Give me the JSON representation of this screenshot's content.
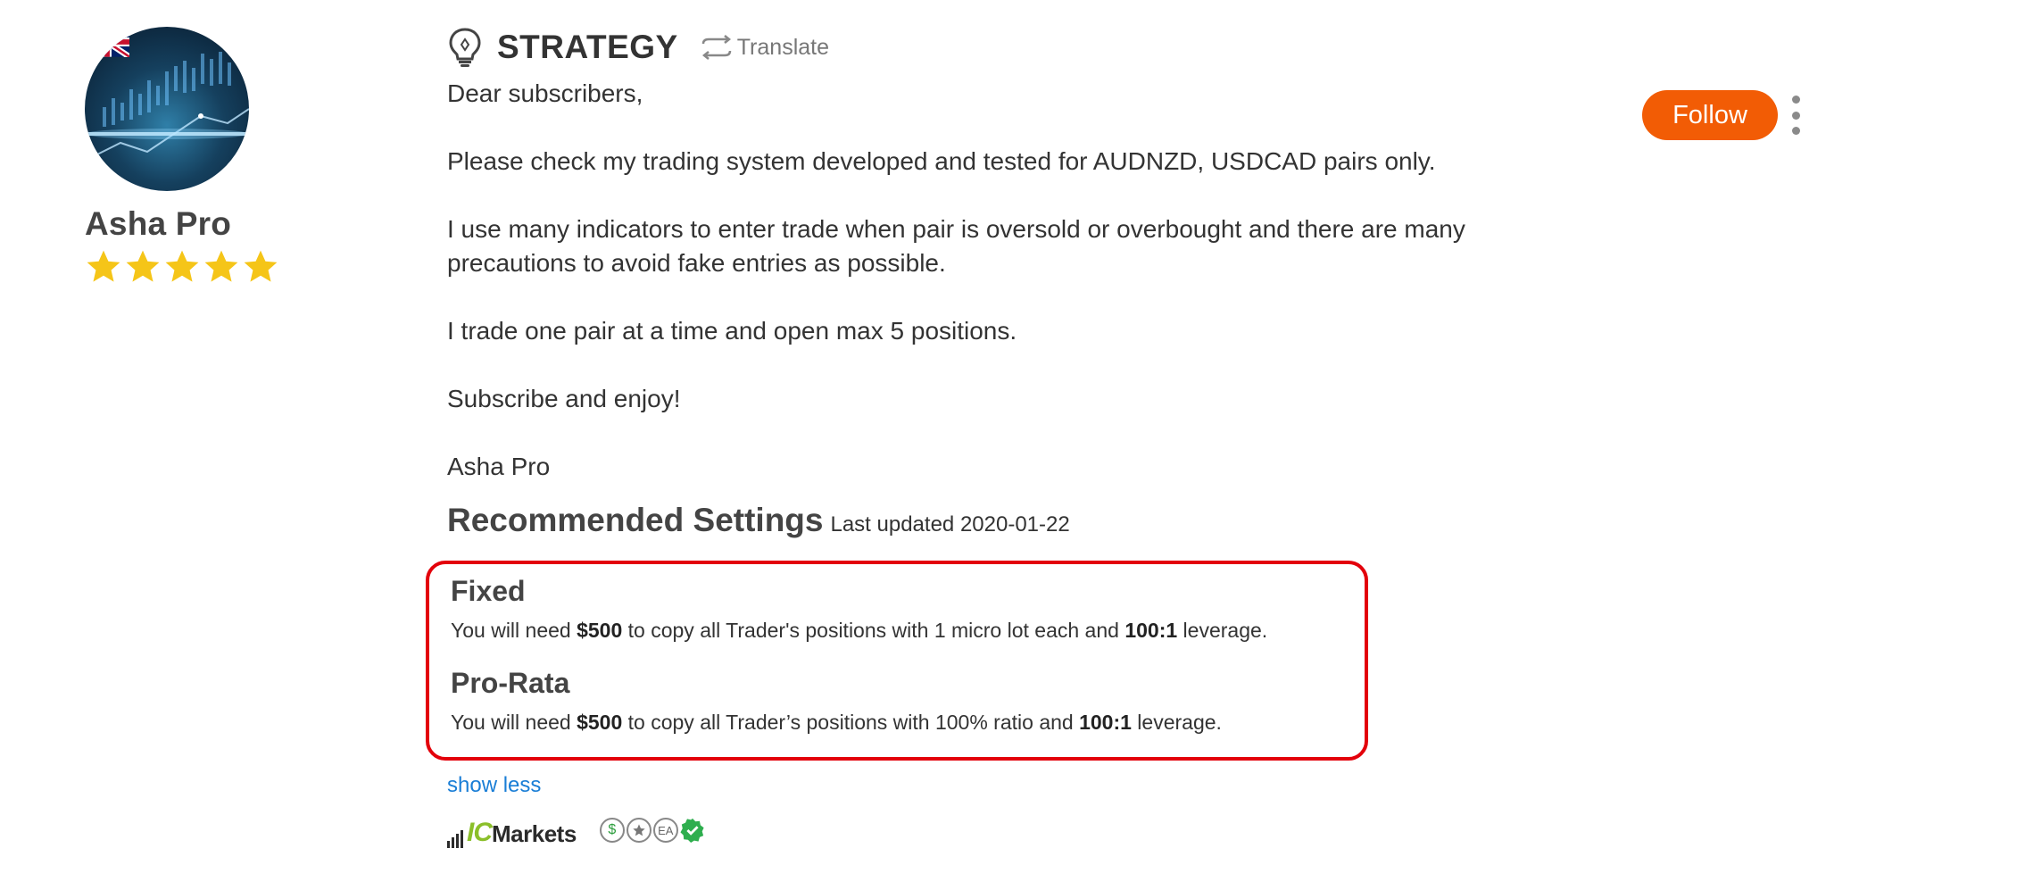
{
  "trader": {
    "name": "Asha Pro",
    "rating": 5,
    "rating_max": 5,
    "country_flag": "uk-flag-icon"
  },
  "strategy": {
    "title": "STRATEGY",
    "translate_label": "Translate",
    "paragraphs": [
      "Dear subscribers,",
      "Please check my trading system developed and tested for AUDNZD, USDCAD pairs only.",
      "I use many indicators to enter trade when pair is oversold or overbought and there are many precautions to avoid fake entries as possible.",
      "I trade one pair at a time and open max 5 positions.",
      "Subscribe and enjoy!",
      "Asha Pro"
    ]
  },
  "recommended": {
    "title": "Recommended Settings",
    "last_updated": "Last updated 2020-01-22",
    "fixed": {
      "title": "Fixed",
      "text_1": "You will need ",
      "amount": "$500",
      "text_2": " to copy all Trader's positions with 1 micro lot each and ",
      "leverage": "100:1",
      "text_3": " leverage."
    },
    "pro_rata": {
      "title": "Pro-Rata",
      "text_1": "You will need ",
      "amount": "$500",
      "text_2": " to copy all Trader’s positions with 100% ratio and ",
      "leverage": "100:1",
      "text_3": " leverage."
    }
  },
  "show_less_label": "show less",
  "broker": {
    "logo_prefix": "IC",
    "logo_suffix": "Markets",
    "badges": [
      "dollar-badge-icon",
      "star-badge-icon",
      "ea-badge-icon",
      "verified-badge-icon"
    ],
    "ea_label": "EA"
  },
  "actions": {
    "follow_label": "Follow"
  },
  "colors": {
    "accent": "#f25c05",
    "highlight_border": "#e3000b",
    "link": "#1a7ed6",
    "star": "#f5c518",
    "verified": "#2eae4e"
  }
}
